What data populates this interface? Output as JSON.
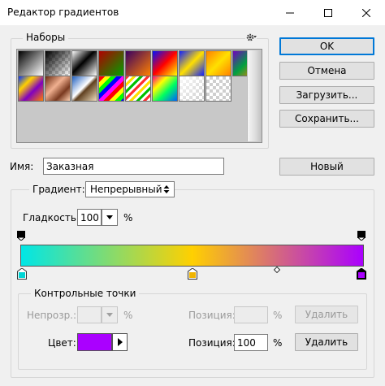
{
  "window": {
    "title": "Редактор градиентов"
  },
  "presets": {
    "legend": "Наборы",
    "swatches_row1": [
      {
        "name": "black-white",
        "css": "linear-gradient(135deg,#000 0%,#fff 100%)"
      },
      {
        "name": "black-transparent",
        "css": "linear-gradient(135deg,#000 0%,rgba(0,0,0,0) 100%)"
      },
      {
        "name": "black-white-2",
        "css": "linear-gradient(135deg,#fff 0%,#000 45%,#fff 100%)"
      },
      {
        "name": "red-green",
        "css": "linear-gradient(135deg,#b00000 0%,#00a000 100%)"
      },
      {
        "name": "violet-orange",
        "css": "linear-gradient(135deg,#3a0060 0%,#ff8000 100%)"
      },
      {
        "name": "blue-red-yellow",
        "css": "linear-gradient(135deg,#0010ff 0%,#ff0000 50%,#ffff00 100%)"
      },
      {
        "name": "blue-yellow-blue",
        "css": "linear-gradient(135deg,#1020ff 0%,#ffe000 50%,#1020ff 100%)"
      },
      {
        "name": "orange-yellow-orange",
        "css": "linear-gradient(135deg,#ff8000 0%,#ffe000 50%,#ff8000 100%)"
      },
      {
        "name": "violet-green-orange",
        "css": "linear-gradient(135deg,#7000c0 0%,#00a040 50%,#ff8000 100%)"
      }
    ],
    "swatches_row2": [
      {
        "name": "yellow-violet-orange-blue",
        "css": "linear-gradient(135deg,#0030ff 0%,#ffd000 30%,#8000c0 60%,#ff8000 100%)"
      },
      {
        "name": "copper",
        "css": "linear-gradient(135deg,#6a2a10 0%,#f0b090 40%,#7a3a20 70%,#ffd0b0 100%)"
      },
      {
        "name": "chrome",
        "css": "linear-gradient(135deg,#2060c0 0%,#ffffff 45%,#604020 55%,#f0e0c0 100%)"
      },
      {
        "name": "rainbow-stripes",
        "css": "repeating-linear-gradient(135deg,#ff0000 0 5px,#ffff00 5px 10px,#00ff00 10px 15px,#0000ff 15px 20px,#ff00ff 20px 25px)"
      },
      {
        "name": "transparent-stripes",
        "css": "repeating-linear-gradient(135deg,#ff3030 0 3px,#ffffff 3px 6px,#ffe000 6px 9px,#ffffff 9px 12px,#00c000 12px 15px,#ffffff 15px 18px)"
      },
      {
        "name": "transparent-rainbow",
        "css": "linear-gradient(135deg,#ff0080 0%,#ffff00 30%,#00ff60 60%,#0060ff 100%)"
      },
      {
        "name": "foreground-to-transparent",
        "css": "linear-gradient(135deg,rgba(255,255,255,0.9) 0%,rgba(255,255,255,0) 100%)"
      },
      {
        "name": "transparent",
        "css": "linear-gradient(135deg,rgba(255,255,255,0) 0%,rgba(255,255,255,0) 100%)"
      }
    ]
  },
  "buttons": {
    "ok": "OK",
    "cancel": "Отмена",
    "load": "Загрузить...",
    "save": "Сохранить...",
    "new": "Новый"
  },
  "name_field": {
    "label": "Имя:",
    "value": "Заказная"
  },
  "gradient": {
    "type_label": "Градиент:",
    "type_value": "Непрерывный",
    "smoothness_label": "Гладкость:",
    "smoothness_value": "100",
    "smoothness_unit": "%",
    "bar_colors": [
      "#00e6e6",
      "#ffd000",
      "#aa00ff"
    ],
    "color_stops": [
      {
        "color": "#00d4d4",
        "selected": false
      },
      {
        "color": "#f0b400",
        "selected": false
      },
      {
        "color": "#aa00ff",
        "selected": true
      }
    ]
  },
  "stops_panel": {
    "legend": "Контрольные точки",
    "opacity_label": "Непрозр.:",
    "opacity_unit": "%",
    "location_label_top": "Позиция:",
    "location_unit_top": "%",
    "delete_top": "Удалить",
    "color_label": "Цвет:",
    "color_value": "#aa00ff",
    "location_label_bottom": "Позиция:",
    "location_value_bottom": "100",
    "location_unit_bottom": "%",
    "delete_bottom": "Удалить"
  }
}
